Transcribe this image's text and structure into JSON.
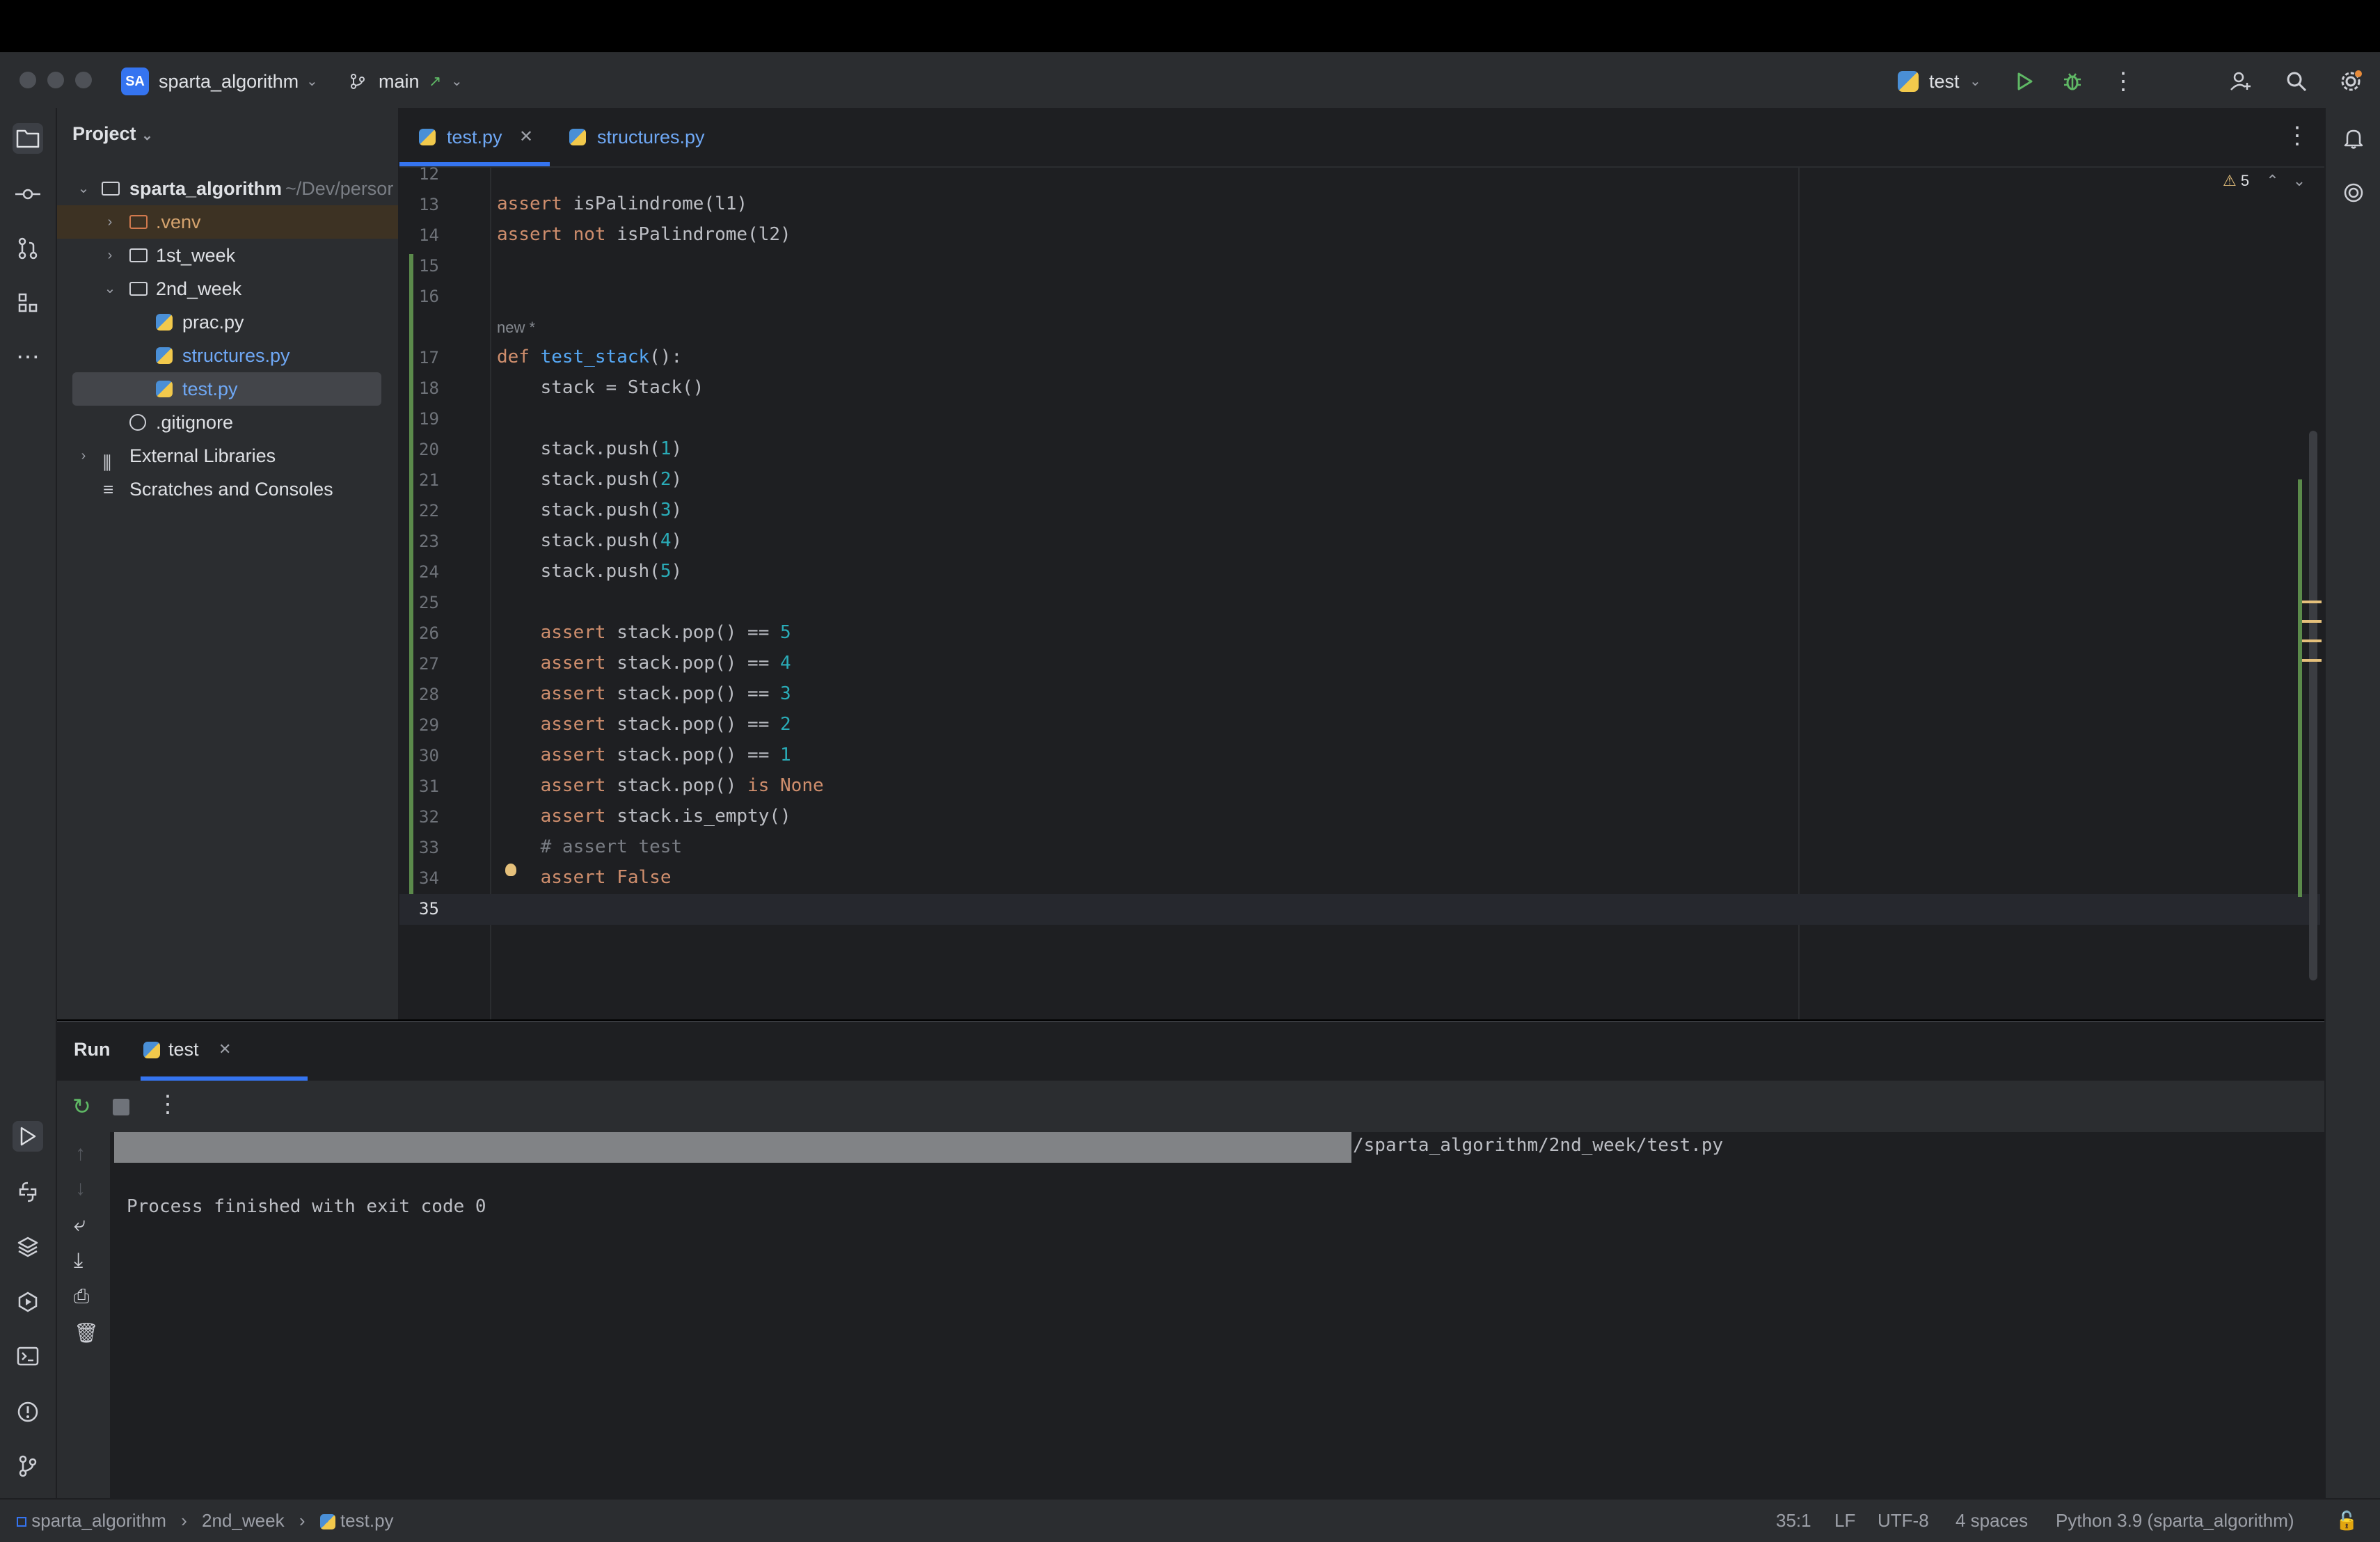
{
  "topbar": {
    "project_badge": "SA",
    "project_name": "sparta_algorithm",
    "branch": "main",
    "run_config": "test"
  },
  "project_panel": {
    "title": "Project",
    "tree": [
      {
        "label": "sparta_algorithm",
        "path": "~/Dev/persor"
      },
      {
        "label": ".venv"
      },
      {
        "label": "1st_week"
      },
      {
        "label": "2nd_week"
      },
      {
        "label": "prac.py"
      },
      {
        "label": "structures.py"
      },
      {
        "label": "test.py"
      },
      {
        "label": ".gitignore"
      },
      {
        "label": "External Libraries"
      },
      {
        "label": "Scratches and Consoles"
      }
    ]
  },
  "editor": {
    "tabs": [
      {
        "label": "test.py",
        "active": true
      },
      {
        "label": "structures.py",
        "active": false
      }
    ],
    "warnings_count": "5",
    "hint": "new *",
    "line_numbers": [
      "12",
      "13",
      "14",
      "15",
      "16",
      "17",
      "18",
      "19",
      "20",
      "21",
      "22",
      "23",
      "24",
      "25",
      "26",
      "27",
      "28",
      "29",
      "30",
      "31",
      "32",
      "33",
      "34",
      "35"
    ],
    "code": {
      "l13_kw": "assert",
      "l13_rest": " isPalindrome(l1)",
      "l14_kw": "assert",
      "l14_not": " not",
      "l14_rest": " isPalindrome(l2)",
      "l17_kw": "def",
      "l17_fn": " test_stack",
      "l17_rest": "():",
      "l18": "    stack = Stack()",
      "push_prefix": "    stack.push(",
      "push_vals": [
        "1",
        "2",
        "3",
        "4",
        "5"
      ],
      "push_suffix": ")",
      "assert_kw": "    assert",
      "pop_expr": " stack.pop() == ",
      "pop_vals": [
        "5",
        "4",
        "3",
        "2",
        "1"
      ],
      "l31_mid": " stack.pop() ",
      "l31_is": "is",
      "l31_none": " None",
      "l32_rest": " stack.is_empty()",
      "l33": "    # assert test",
      "l34_false": " False"
    }
  },
  "run_panel": {
    "title": "Run",
    "tab": "test",
    "command_suffix": "/sparta_algorithm/2nd_week/test.py",
    "output": "Process finished with exit code 0"
  },
  "statusbar": {
    "crumbs": [
      "sparta_algorithm",
      "2nd_week",
      "test.py"
    ],
    "position": "35:1",
    "line_sep": "LF",
    "encoding": "UTF-8",
    "indent": "4 spaces",
    "interpreter": "Python 3.9 (sparta_algorithm)"
  },
  "colors": {
    "accent": "#3574f0",
    "keyword": "#cf8e6d",
    "function": "#56a8f5",
    "number": "#2aacb8",
    "vcs_added": "#5b8a4b",
    "warning": "#e5c07b"
  }
}
